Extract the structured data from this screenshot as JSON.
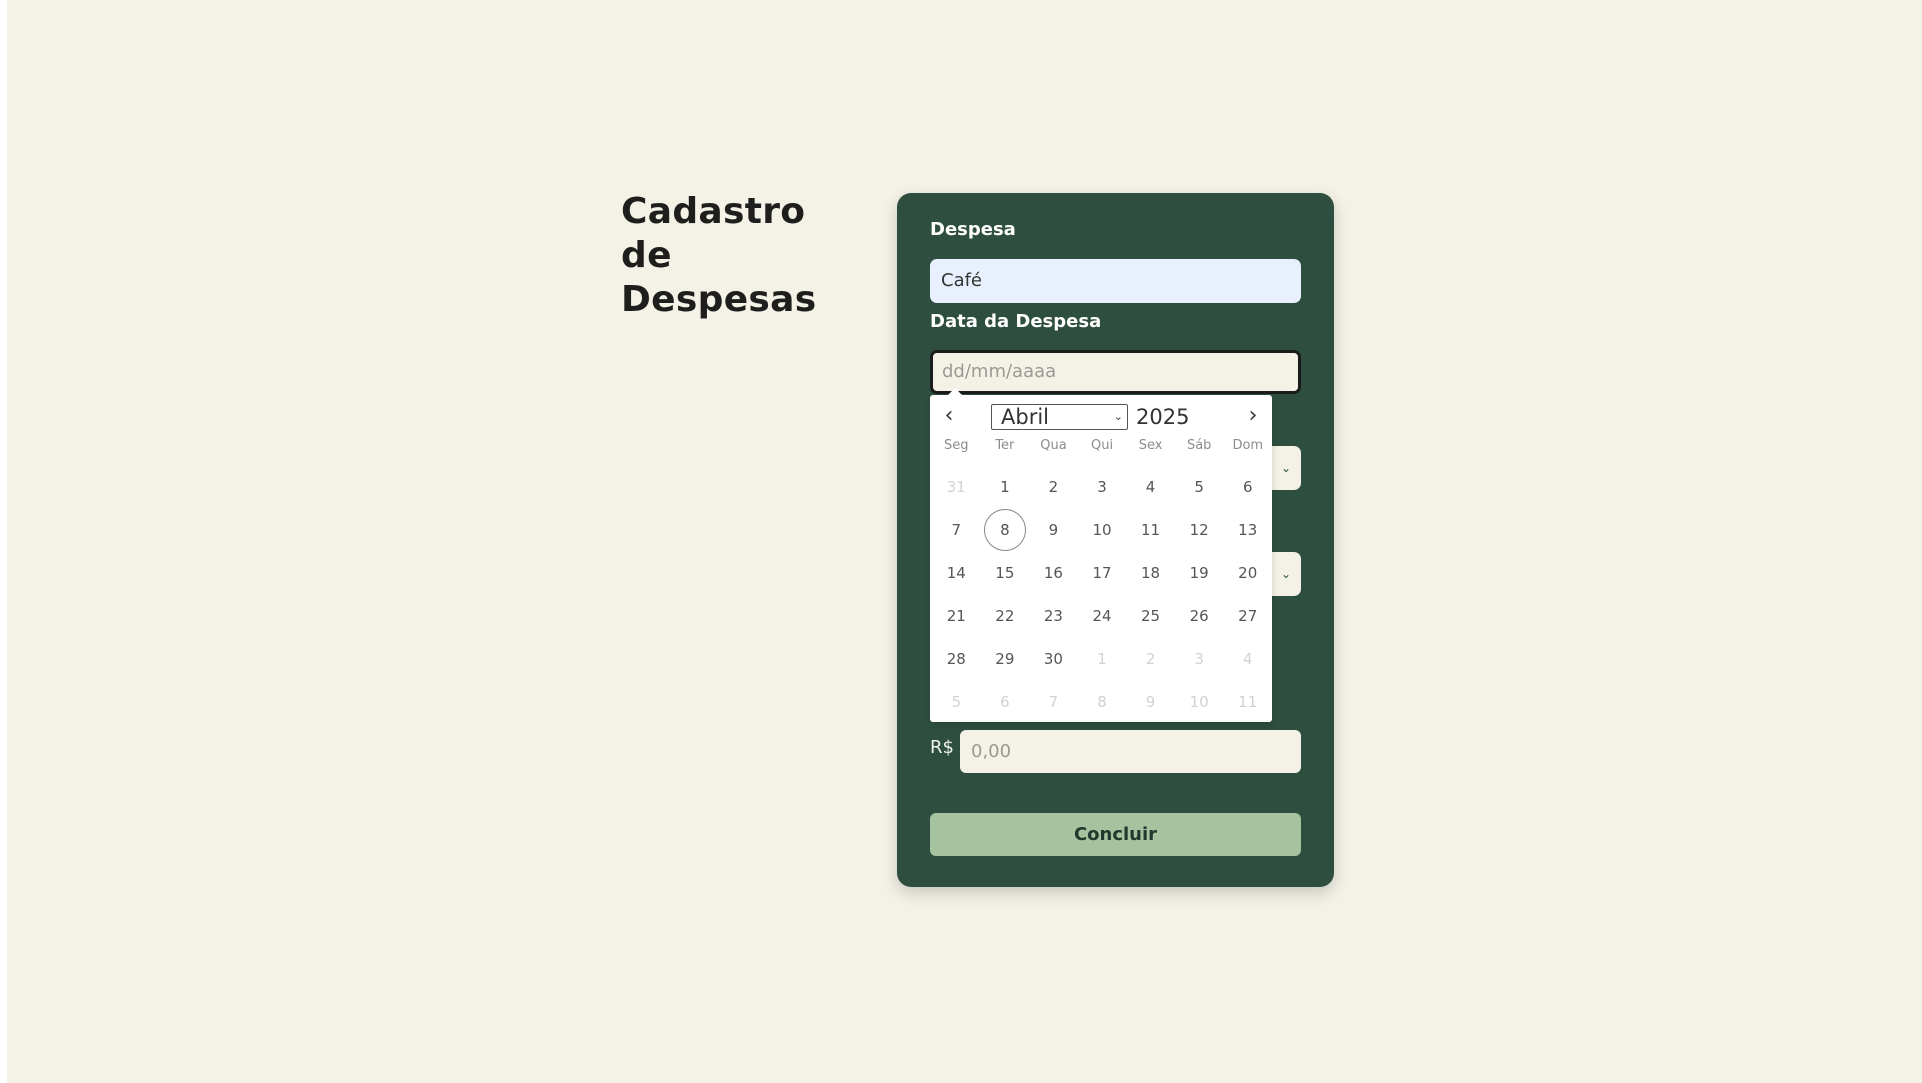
{
  "page": {
    "title_lines": [
      "Cadastro",
      "de",
      "Despesas"
    ]
  },
  "form": {
    "despesa_label": "Despesa",
    "despesa_value": "Café",
    "data_label": "Data da Despesa",
    "data_placeholder": "dd/mm/aaaa",
    "currency_symbol": "R$",
    "valor_placeholder": "0,00",
    "submit_label": "Concluir"
  },
  "datepicker": {
    "month": "Abril",
    "year": "2025",
    "weekdays": [
      "Seg",
      "Ter",
      "Qua",
      "Qui",
      "Sex",
      "Sáb",
      "Dom"
    ],
    "today": "8",
    "days": [
      {
        "d": "31",
        "muted": true
      },
      {
        "d": "1"
      },
      {
        "d": "2"
      },
      {
        "d": "3"
      },
      {
        "d": "4"
      },
      {
        "d": "5"
      },
      {
        "d": "6"
      },
      {
        "d": "7"
      },
      {
        "d": "8",
        "today": true
      },
      {
        "d": "9"
      },
      {
        "d": "10"
      },
      {
        "d": "11"
      },
      {
        "d": "12"
      },
      {
        "d": "13"
      },
      {
        "d": "14"
      },
      {
        "d": "15"
      },
      {
        "d": "16"
      },
      {
        "d": "17"
      },
      {
        "d": "18"
      },
      {
        "d": "19"
      },
      {
        "d": "20"
      },
      {
        "d": "21"
      },
      {
        "d": "22"
      },
      {
        "d": "23"
      },
      {
        "d": "24"
      },
      {
        "d": "25"
      },
      {
        "d": "26"
      },
      {
        "d": "27"
      },
      {
        "d": "28"
      },
      {
        "d": "29"
      },
      {
        "d": "30"
      },
      {
        "d": "1",
        "muted": true
      },
      {
        "d": "2",
        "muted": true
      },
      {
        "d": "3",
        "muted": true
      },
      {
        "d": "4",
        "muted": true
      },
      {
        "d": "5",
        "muted": true
      },
      {
        "d": "6",
        "muted": true
      },
      {
        "d": "7",
        "muted": true
      },
      {
        "d": "8",
        "muted": true
      },
      {
        "d": "9",
        "muted": true
      },
      {
        "d": "10",
        "muted": true
      },
      {
        "d": "11",
        "muted": true
      }
    ]
  },
  "icons": {
    "prev": "chevron-left-icon",
    "next": "chevron-right-icon",
    "dropdown": "chevron-down-icon"
  },
  "colors": {
    "page_bg": "#f4f2e7",
    "card_bg": "#2e4f3f",
    "button_bg": "#a5c39f",
    "input_active_bg": "#e8effd"
  }
}
